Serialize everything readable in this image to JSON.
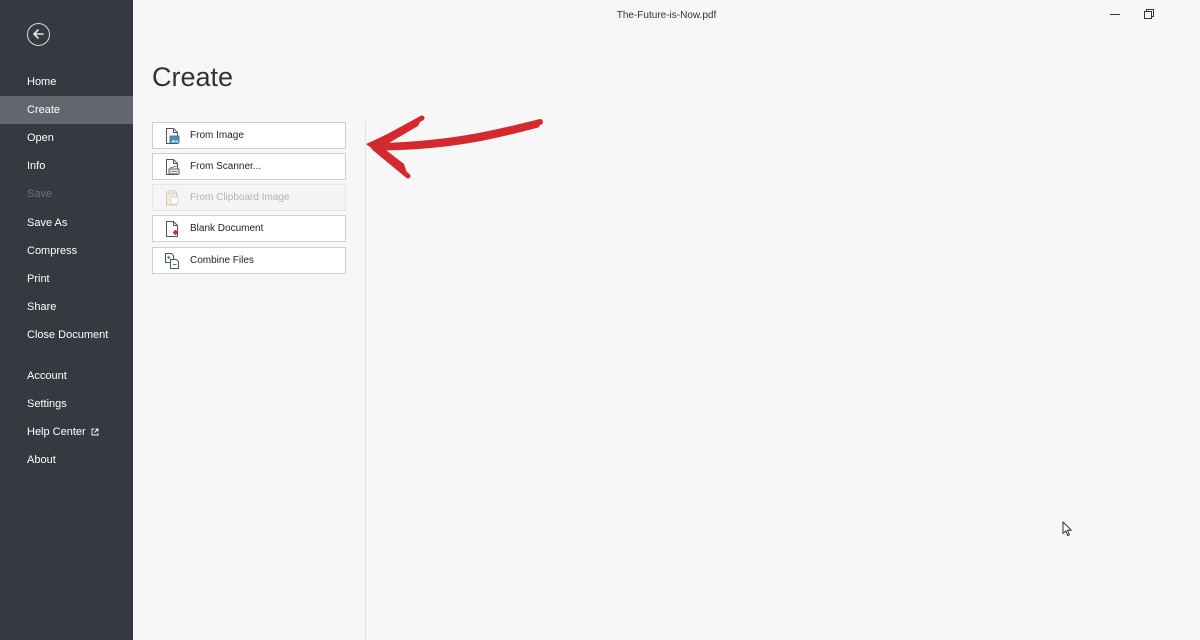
{
  "window": {
    "title": "The-Future-is-Now.pdf",
    "controls": [
      "minimize-icon",
      "restore-icon"
    ]
  },
  "sidebar": {
    "back_icon": "back-arrow-icon",
    "items": [
      {
        "label": "Home",
        "state": "normal"
      },
      {
        "label": "Create",
        "state": "active"
      },
      {
        "label": "Open",
        "state": "normal"
      },
      {
        "label": "Info",
        "state": "normal"
      },
      {
        "label": "Save",
        "state": "disabled"
      },
      {
        "label": "Save As",
        "state": "normal"
      },
      {
        "label": "Compress",
        "state": "normal"
      },
      {
        "label": "Print",
        "state": "normal"
      },
      {
        "label": "Share",
        "state": "normal"
      },
      {
        "label": "Close Document",
        "state": "normal"
      },
      {
        "label": "Account",
        "state": "normal"
      },
      {
        "label": "Settings",
        "state": "normal"
      },
      {
        "label": "Help Center",
        "state": "normal",
        "icon": "external-link-icon"
      },
      {
        "label": "About",
        "state": "normal"
      }
    ]
  },
  "main": {
    "title": "Create",
    "options": [
      {
        "label": "From Image",
        "icon": "image-file-icon",
        "enabled": true
      },
      {
        "label": "From Scanner...",
        "icon": "scanner-icon",
        "enabled": true
      },
      {
        "label": "From Clipboard Image",
        "icon": "clipboard-icon",
        "enabled": false
      },
      {
        "label": "Blank Document",
        "icon": "blank-document-icon",
        "enabled": true
      },
      {
        "label": "Combine Files",
        "icon": "combine-files-icon",
        "enabled": true
      }
    ]
  },
  "colors": {
    "sidebar_bg": "#353a40",
    "sidebar_active": "#62676d",
    "annotation_arrow": "#d42a2f"
  }
}
